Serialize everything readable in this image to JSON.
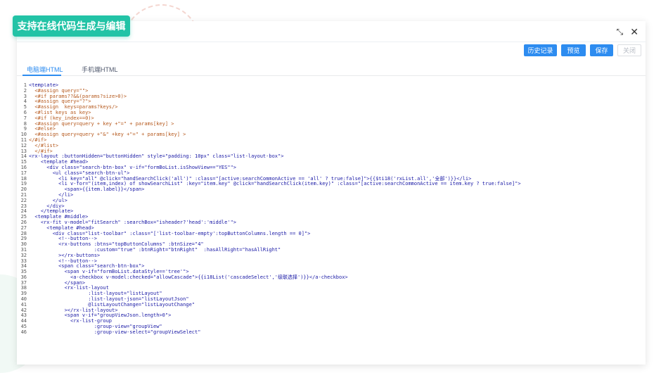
{
  "feature_tag": "支持在线代码生成与编辑",
  "window_controls": {
    "minimize_icon": "collapse-icon",
    "close_icon": "close-icon"
  },
  "toolbar": {
    "history_label": "历史记录",
    "preview_label": "预览",
    "save_label": "保存",
    "close_label": "关闭"
  },
  "tabs": [
    {
      "label": "电脑端HTML",
      "active": true
    },
    {
      "label": "手机端HTML",
      "active": false
    }
  ],
  "colors": {
    "accent": "#2d8cf0",
    "tag": "#22c3a6",
    "tag_text": "#1a1aa6",
    "freemarker": "#b5581c"
  },
  "code_lines": [
    "<template>",
    "  <#assign query=\"\">",
    "  <#if params??&&(params?size>0)>",
    "  <#assign query=\"?\">",
    "  <#assign  keys=params?keys/>",
    "  <#list keys as key>",
    "  <#if (key_index==0)>",
    "  <#assign query=query + key +\"=\" + params[key] >",
    "  <#else>",
    "  <#assign query=query +\"&\" +key +\"=\" + params[key] >",
    "</#if>",
    "  </#list>",
    "  </#if>",
    "<rx-layout :buttonHidden=\"buttonHidden\" style=\"padding: 10px\" class=\"list-layout-box\">",
    "    <template #head>",
    "      <div class=\"search-btn-box\" v-if=\"formBoList.isShowView==\"YES\"\">",
    "        <ul class=\"search-btn-ul\">",
    "          <li key=\"all\" @click=\"handSearchClick('all')\" :class=\"[active:searchCommonActive == 'all' ? true:false]\">{{$ti18('rxList.all','全部')}}</li>",
    "          <li v-for=\"(item,index) of showSearchList\" :key=\"item.key\" @click=\"handSearchClick(item.key)\" :class=\"[active:searchCommonActive == item.key ? true:false]\">",
    "            <span>{{item.label}}</span>",
    "          </li>",
    "        </ul>",
    "      </div>",
    "    </template>",
    "  <template #middle>",
    "    <rx-fit v-model=\"fitSearch\" :searchBox=\"isheader?'head':'middle'\">",
    "      <template #head>",
    "        <div class=\"list-toolbar\" :class=\"['list-toolbar-empty':topButtonColumns.length == 0]\">",
    "          <!--button-->",
    "          <rx-buttons :btns=\"topButtonColumns\" :btnSize=\"4\"",
    "                      :custom=\"true\" :btnRight=\"btnRight\"  :hasAllRight=\"hasAllRight\"",
    "          ></rx-buttons>",
    "          <!--button-->",
    "          <span class=\"search-btn-box\">",
    "            <span v-if=\"formBoList.dataStyle=='tree'\">",
    "              <a-checkbox v-model:checked=\"allowCascade\">{{i18List('cascadeSelect','级联选择')}}</a-checkbox>",
    "            </span>",
    "            <rx-list-layout",
    "                    :list-layout=\"listLayout\"",
    "                    :list-layout-json=\"listLayoutJson\"",
    "                    @listLayoutChange=\"listLayoutChange\"",
    "            ></rx-list-layout>",
    "            <span v-if=\"groupViewJson.length>0\">",
    "              <rx-list-group",
    "                      :group-view=\"groupView\"",
    "                      :group-view-select=\"groupViewSelect\""
  ]
}
